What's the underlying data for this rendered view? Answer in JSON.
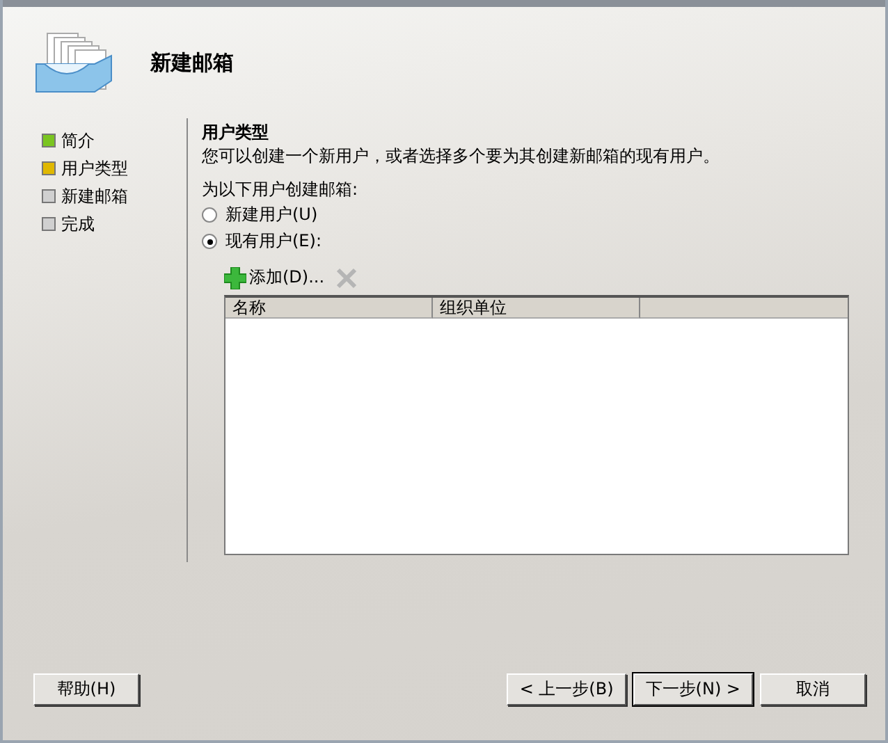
{
  "header": {
    "title": "新建邮箱"
  },
  "steps": [
    {
      "label": "简介",
      "kind": "done"
    },
    {
      "label": "用户类型",
      "kind": "current"
    },
    {
      "label": "新建邮箱",
      "kind": "pending"
    },
    {
      "label": "完成",
      "kind": "pending"
    }
  ],
  "section": {
    "title": "用户类型",
    "description": "您可以创建一个新用户，或者选择多个要为其创建新邮箱的现有用户。",
    "prompt": "为以下用户创建邮箱:"
  },
  "options": [
    {
      "label": "新建用户(U)",
      "selected": false
    },
    {
      "label": "现有用户(E):",
      "selected": true
    }
  ],
  "toolbar": {
    "add": "添加(D)...",
    "remove_disabled": true
  },
  "table": {
    "columns": [
      "名称",
      "组织单位"
    ]
  },
  "buttons": {
    "help": "帮助(H)",
    "back": "< 上一步(B)",
    "next": "下一步(N) >",
    "cancel": "取消"
  }
}
